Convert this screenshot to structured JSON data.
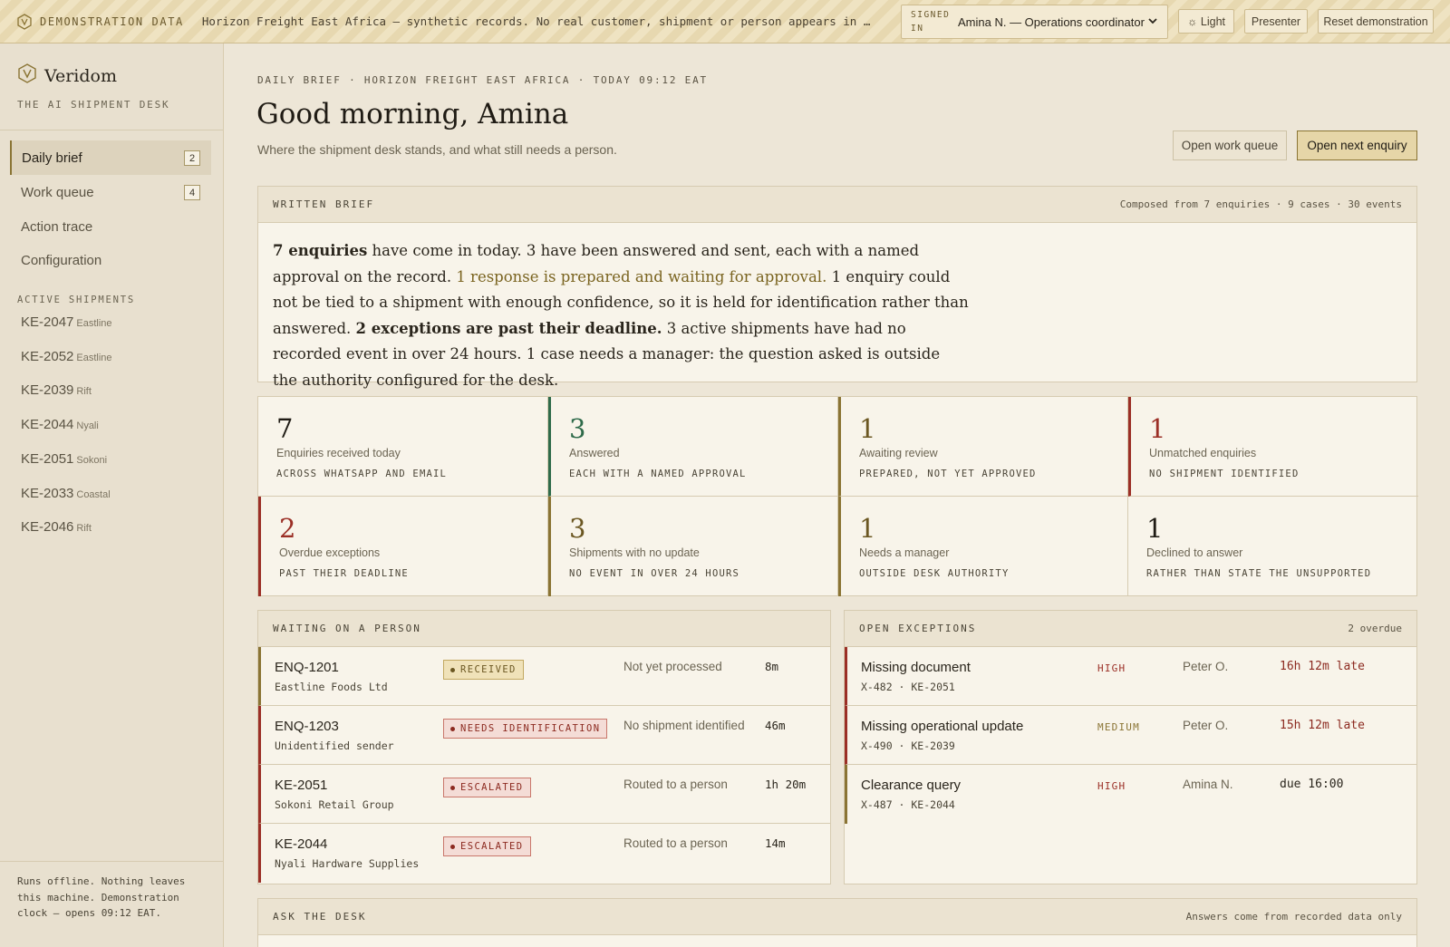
{
  "banner": {
    "tag": "DEMONSTRATION DATA",
    "message": "Horizon Freight East Africa — synthetic records. No real customer, shipment or person appears in this demonstration.",
    "signed_in_label_1": "SIGNED",
    "signed_in_label_2": "IN",
    "signed_in_user": "Amina N. — Operations coordinator",
    "theme_button": "☼ Light",
    "presenter_button": "Presenter",
    "reset_button": "Reset demonstration"
  },
  "sidebar": {
    "brand": "Veridom",
    "brand_sub": "THE AI SHIPMENT DESK",
    "nav": [
      {
        "label": "Daily brief",
        "badge": "2"
      },
      {
        "label": "Work queue",
        "badge": "4"
      },
      {
        "label": "Action trace"
      },
      {
        "label": "Configuration"
      }
    ],
    "shipments_heading": "ACTIVE SHIPMENTS",
    "shipments": [
      {
        "id": "KE-2047",
        "route": "Eastline"
      },
      {
        "id": "KE-2052",
        "route": "Eastline"
      },
      {
        "id": "KE-2039",
        "route": "Rift"
      },
      {
        "id": "KE-2044",
        "route": "Nyali"
      },
      {
        "id": "KE-2051",
        "route": "Sokoni"
      },
      {
        "id": "KE-2033",
        "route": "Coastal"
      },
      {
        "id": "KE-2046",
        "route": "Rift"
      }
    ],
    "footer": "Runs offline. Nothing leaves this machine. Demonstration clock — opens 09:12 EAT."
  },
  "header": {
    "eyebrow": "DAILY BRIEF · HORIZON FREIGHT EAST AFRICA · TODAY 09:12 EAT",
    "greeting": "Good morning, Amina",
    "subtitle": "Where the shipment desk stands, and what still needs a person.",
    "queue_button": "Open work queue",
    "next_button": "Open next enquiry"
  },
  "brief": {
    "title": "WRITTEN BRIEF",
    "meta": "Composed from 7 enquiries · 9 cases · 30 events",
    "p1_bold": "7 enquiries",
    "p1": " have come in today. 3 have been answered and sent, each with a named approval on the record. ",
    "p2_highlight": "1 response is prepared and waiting for approval.",
    "p3": " 1 enquiry could not be tied to a shipment with enough confidence, so it is held for identification rather than answered. ",
    "p4_bold": "2 exceptions are past their deadline.",
    "p5": " 3 active shipments have had no recorded event in over 24 hours. 1 case needs a manager: the question asked is outside the authority configured for the desk."
  },
  "stats": [
    {
      "value": "7",
      "label": "Enquiries received today",
      "sub": "ACROSS WHATSAPP AND EMAIL",
      "color": "#1f1b14"
    },
    {
      "value": "3",
      "label": "Answered",
      "sub": "EACH WITH A NAMED APPROVAL",
      "color": "#2f6b4a"
    },
    {
      "value": "1",
      "label": "Awaiting review",
      "sub": "PREPARED, NOT YET APPROVED",
      "color": "#6b5722"
    },
    {
      "value": "1",
      "label": "Unmatched enquiries",
      "sub": "NO SHIPMENT IDENTIFIED",
      "color": "#9b2f26"
    },
    {
      "value": "2",
      "label": "Overdue exceptions",
      "sub": "PAST THEIR DEADLINE",
      "color": "#9b2f26"
    },
    {
      "value": "3",
      "label": "Shipments with no update",
      "sub": "NO EVENT IN OVER 24 HOURS",
      "color": "#6b5722"
    },
    {
      "value": "1",
      "label": "Needs a manager",
      "sub": "OUTSIDE DESK AUTHORITY",
      "color": "#6b5722"
    },
    {
      "value": "1",
      "label": "Declined to answer",
      "sub": "RATHER THAN STATE THE UNSUPPORTED",
      "color": "#1f1b14"
    }
  ],
  "waiting": {
    "title": "WAITING ON A PERSON",
    "rows": [
      {
        "id": "ENQ-1201",
        "sub": "Eastline Foods Ltd",
        "pill": "RECEIVED",
        "status": "Not yet processed",
        "age": "8m"
      },
      {
        "id": "ENQ-1203",
        "sub": "Unidentified sender",
        "pill": "NEEDS IDENTIFICATION",
        "status": "No shipment identified",
        "age": "46m"
      },
      {
        "id": "KE-2051",
        "sub": "Sokoni Retail Group",
        "pill": "ESCALATED",
        "status": "Routed to a person",
        "age": "1h 20m"
      },
      {
        "id": "KE-2044",
        "sub": "Nyali Hardware Supplies",
        "pill": "ESCALATED",
        "status": "Routed to a person",
        "age": "14m"
      }
    ]
  },
  "exceptions": {
    "title": "OPEN EXCEPTIONS",
    "meta": "2 overdue",
    "rows": [
      {
        "title": "Missing document",
        "sub": "X-482 · KE-2051",
        "severity": "HIGH",
        "owner": "Peter O.",
        "due": "16h 12m late"
      },
      {
        "title": "Missing operational update",
        "sub": "X-490 · KE-2039",
        "severity": "MEDIUM",
        "owner": "Peter O.",
        "due": "15h 12m late"
      },
      {
        "title": "Clearance query",
        "sub": "X-487 · KE-2044",
        "severity": "HIGH",
        "owner": "Amina N.",
        "due": "due 16:00"
      }
    ]
  },
  "ask": {
    "title": "ASK THE DESK",
    "meta": "Answers come from recorded data only"
  }
}
